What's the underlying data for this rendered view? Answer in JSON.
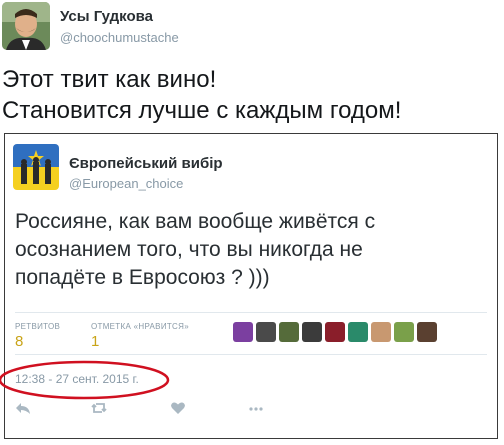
{
  "outer_tweet": {
    "name": "Усы Гудкова",
    "handle": "@choochumustache",
    "text_lines": [
      "Этот твит как вино!",
      "Становится лучше с каждым годом!"
    ]
  },
  "embedded_tweet": {
    "name": "Європейський вибір",
    "handle": "@European_choice",
    "text_lines": [
      "Россияне, как вам вообще живётся с",
      "осознанием того, что вы никогда не",
      "попадёте в Евросоюз ? )))"
    ],
    "retweets_label": "РЕТВИТОВ",
    "retweets_count": "8",
    "likes_label": "ОТМЕТКА «НРАВИТСЯ»",
    "likes_count": "1",
    "timestamp": "12:38 - 27 сент. 2015 г.",
    "liker_colors": [
      "#7b3fa0",
      "#4a4a4a",
      "#556b3a",
      "#3b3b3b",
      "#8a1e2a",
      "#2a8a6a",
      "#c89870",
      "#7aa04a",
      "#5a4030"
    ],
    "actions": [
      "reply-icon",
      "retweet-icon",
      "like-icon",
      "more-icon"
    ]
  },
  "colors": {
    "stat_value": "#c9a418",
    "muted": "#8899a6",
    "annotation": "#d01020"
  }
}
